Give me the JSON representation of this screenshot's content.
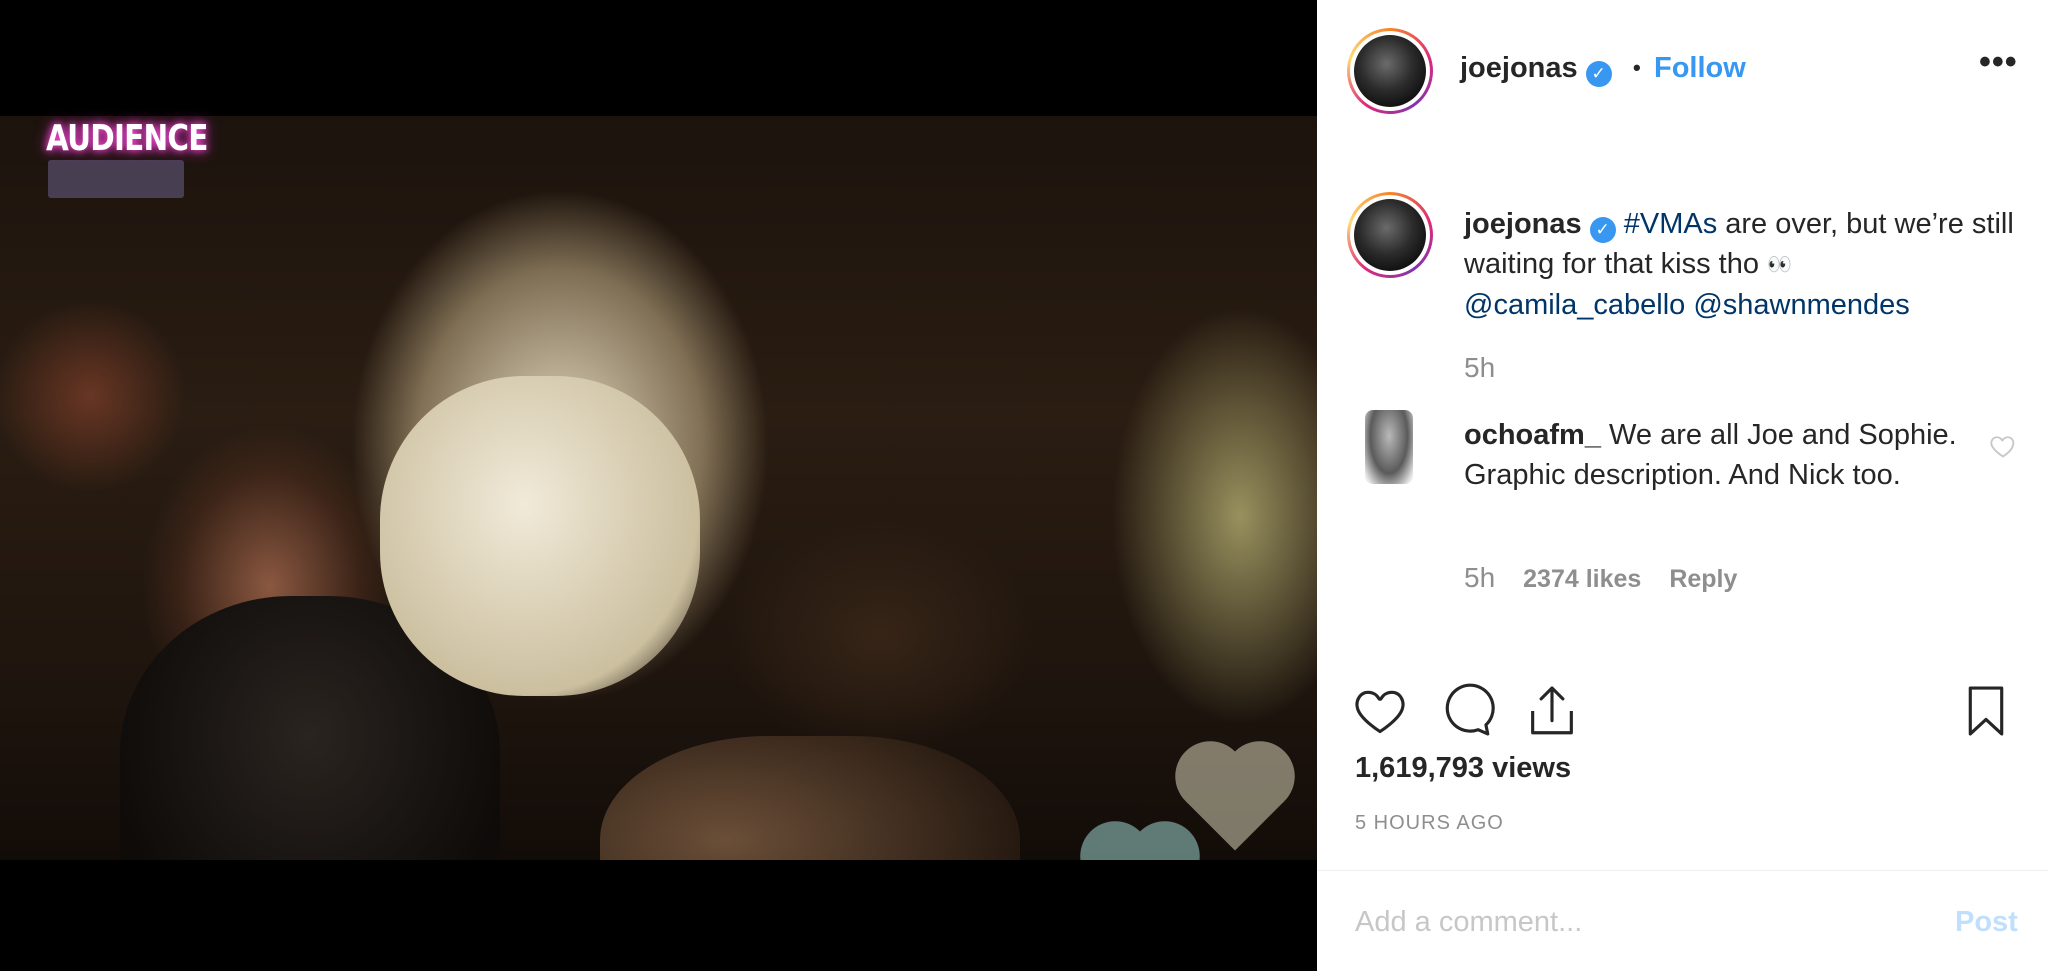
{
  "media": {
    "badge_text": "AUDIENCE"
  },
  "post": {
    "username": "joejonas",
    "follow_label": "Follow",
    "separator": "•",
    "more_label": "•••",
    "caption": {
      "username": "joejonas",
      "hashtag": "#VMAs",
      "text_after_hashtag": " are over, but we’re still waiting for that kiss tho ",
      "emoji": "👀",
      "mention1": "@camila_cabello",
      "mention2": "@shawnmendes",
      "time": "5h"
    },
    "comment": {
      "username": "ochoafm_",
      "text": "We are all Joe and Sophie. Graphic description. And Nick too.",
      "time": "5h",
      "likes": "2374 likes",
      "reply_label": "Reply"
    },
    "views": "1,619,793 views",
    "posted_ago": "5 HOURS AGO",
    "add_comment_placeholder": "Add a comment...",
    "post_label": "Post"
  },
  "icons": {
    "like": "heart-icon",
    "comment": "comment-bubble-icon",
    "share": "share-icon",
    "save": "bookmark-icon",
    "verified": "verified-badge-icon"
  },
  "colors": {
    "link_blue": "#3897f0",
    "mention_navy": "#003569",
    "muted_text": "#8e8e8e",
    "post_disabled": "#c0dffd"
  }
}
